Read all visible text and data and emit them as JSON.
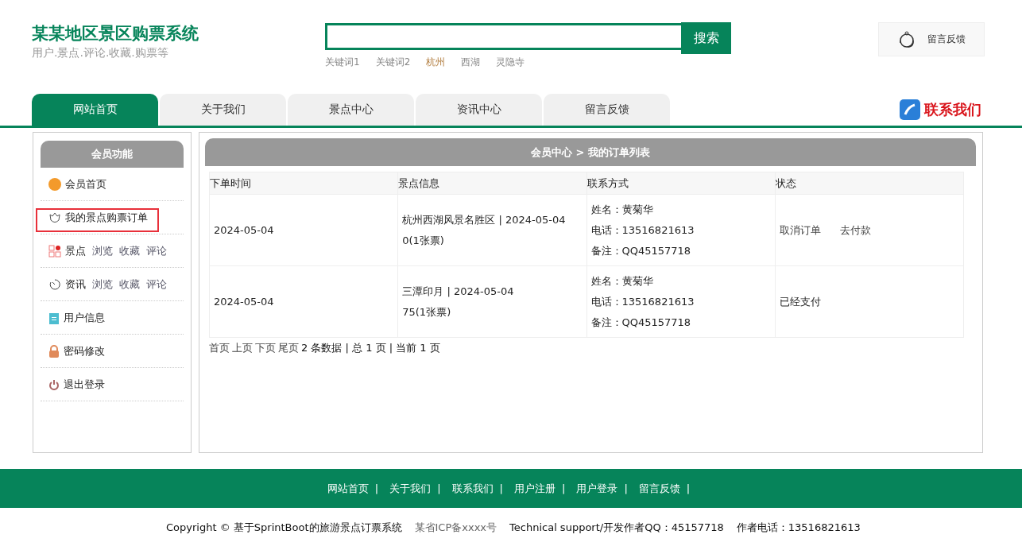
{
  "header": {
    "title": "某某地区景区购票系统",
    "subtitle": "用户.景点.评论.收藏.购票等",
    "search": {
      "button": "搜索",
      "keywords": [
        {
          "label": "关键词1",
          "selected": false
        },
        {
          "label": "关键词2",
          "selected": false
        },
        {
          "label": "杭州",
          "selected": true
        },
        {
          "label": "西湖",
          "selected": false
        },
        {
          "label": "灵隐寺",
          "selected": false
        }
      ]
    },
    "feedback_button": "留言反馈"
  },
  "nav": {
    "tabs": [
      {
        "label": "网站首页",
        "selected": true
      },
      {
        "label": "关于我们",
        "selected": false
      },
      {
        "label": "景点中心",
        "selected": false
      },
      {
        "label": "资讯中心",
        "selected": false
      },
      {
        "label": "留言反馈",
        "selected": false
      }
    ],
    "contact": "联系我们"
  },
  "sidebar": {
    "title": "会员功能",
    "items": [
      {
        "kind": "home",
        "label": "会员首页",
        "highlighted": false
      },
      {
        "kind": "orders",
        "label": "我的景点购票订单",
        "highlighted": true
      },
      {
        "kind": "spots",
        "label": "景点",
        "links": [
          "浏览",
          "收藏",
          "评论"
        ],
        "highlighted": false
      },
      {
        "kind": "news",
        "label": "资讯",
        "links": [
          "浏览",
          "收藏",
          "评论"
        ],
        "highlighted": false
      },
      {
        "kind": "user",
        "label": "用户信息",
        "highlighted": false
      },
      {
        "kind": "lock",
        "label": "密码修改",
        "highlighted": false
      },
      {
        "kind": "logout",
        "label": "退出登录",
        "highlighted": false
      }
    ]
  },
  "main": {
    "breadcrumb": "会员中心 > 我的订单列表",
    "table": {
      "columns": [
        "下单时间",
        "景点信息",
        "联系方式",
        "状态"
      ],
      "rows": [
        {
          "time": "2024-05-04",
          "spot": "杭州西湖风景名胜区 | 2024-05-04",
          "price": "0(1张票)",
          "contact": [
            "姓名：黄菊华",
            "电话：13516821613",
            "备注：QQ45157718"
          ],
          "actions": [
            "取消订单",
            "去付款"
          ]
        },
        {
          "time": "2024-05-04",
          "spot": "三潭印月 | 2024-05-04",
          "price": "75(1张票)",
          "contact": [
            "姓名：黄菊华",
            "电话：13516821613",
            "备注：QQ45157718"
          ],
          "status": "已经支付"
        }
      ]
    },
    "pagination": {
      "links": [
        "首页",
        "上页",
        "下页",
        "尾页"
      ],
      "summary": "2 条数据 | 总 1 页 | 当前 1 页"
    }
  },
  "footer": {
    "links": [
      "网站首页",
      "关于我们",
      "联系我们",
      "用户注册",
      "用户登录",
      "留言反馈"
    ],
    "separator": "|",
    "copyright": "Copyright © 基于SprintBoot的旅游景点订票系统",
    "icp": "某省ICP备xxxx号",
    "support": "Technical support/开发作者QQ：45157718",
    "phone": "作者电话：13516821613"
  }
}
